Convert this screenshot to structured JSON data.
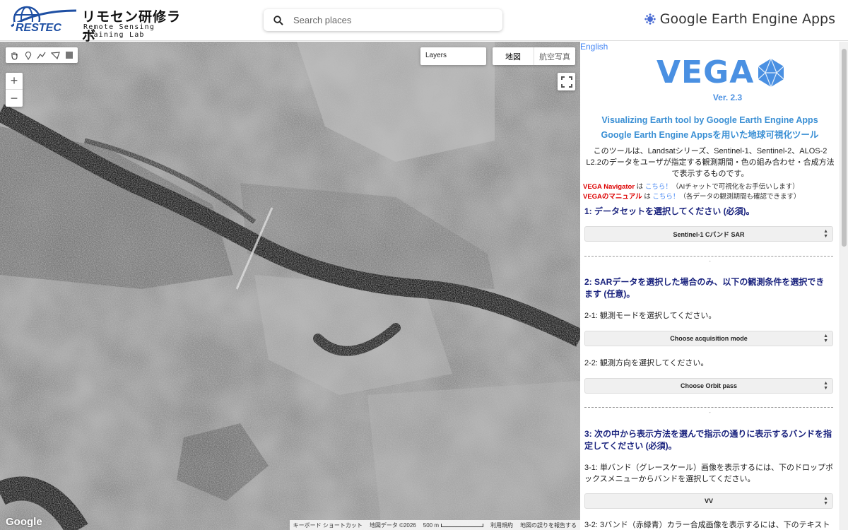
{
  "header": {
    "logo_title": "リモセン研修ラボ",
    "logo_subtitle": "Remote Sensing Training Lab",
    "logo_mark_text": "RESTEC",
    "search_placeholder": "Search places",
    "brand": "Google Earth Engine Apps"
  },
  "map": {
    "layers_label": "Layers",
    "map_type_options": [
      "地図",
      "航空写真"
    ],
    "map_type_selected": "地図",
    "zoom_in": "+",
    "zoom_out": "−",
    "google_logo": "Google",
    "attribution": {
      "shortcuts": "キーボード ショートカット",
      "map_data": "地図データ ©2026",
      "scale": "500 m",
      "terms": "利用規約",
      "report": "地図の誤りを報告する"
    }
  },
  "panel": {
    "language_link": "English",
    "app_title": "VEGA",
    "version": "Ver. 2.3",
    "subtitle_en": "Visualizing Earth tool by Google Earth Engine Apps",
    "subtitle_jp": "Google Earth Engine Appsを用いた地球可視化ツール",
    "description": "このツールは、Landsatシリーズ、Sentinel-1、Sentinel-2、ALOS-2 L2.2のデータをユーザが指定する観測期間・色の組み合わせ・合成方法で表示するものです。",
    "navigator": {
      "label": "VEGA Navigator",
      "mid": " は ",
      "link": "こちら！",
      "note": "（AIチャットで可視化をお手伝いします）"
    },
    "manual": {
      "label": "VEGAのマニュアル",
      "mid": " は ",
      "link": "こちら！",
      "note": "（各データの観測期間も確認できます）"
    },
    "step1_heading": "1: データセットを選択してください (必須)。",
    "dataset_select": "Sentinel-1 Cバンド SAR",
    "step2_heading": "2: SARデータを選択した場合のみ、以下の観測条件を選択できます (任意)。",
    "step2_1_text": "2-1: 観測モードを選択してください。",
    "acquisition_select": "Choose acquisition mode",
    "step2_2_text": "2-2: 観測方向を選択してください。",
    "orbit_select": "Choose Orbit pass",
    "step3_heading": "3: 次の中から表示方法を選んで指示の通りに表示するバンドを指定してください (必須)。",
    "step3_1_text": "3-1: 単バンド（グレースケール）画像を表示するには、下のドロップボックスメニューからバンドを選択してください。",
    "band_select": "VV",
    "step3_2_text": "3-2: 3バンド（赤緑青）カラー合成画像を表示するには、下のテキスト"
  }
}
